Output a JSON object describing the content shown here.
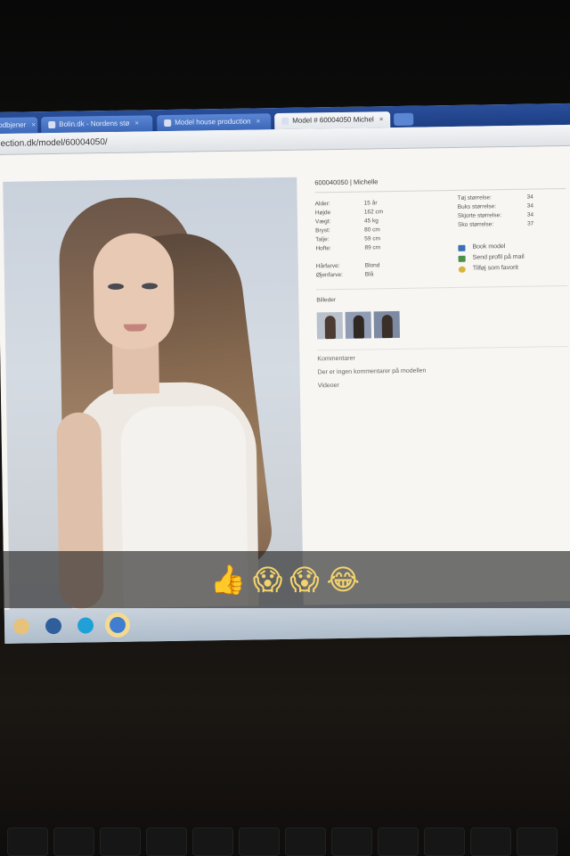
{
  "browser": {
    "tabs": [
      {
        "label": "odbjener"
      },
      {
        "label": "Bolin.dk - Nordens stø"
      },
      {
        "label": "Model house production"
      },
      {
        "label": "Model # 60004050 Michel"
      }
    ],
    "close_glyph": "×",
    "url": "ection.dk/model/60004050/"
  },
  "profile": {
    "header": "600040050 | Michelle",
    "stats": [
      {
        "label": "Alder:",
        "value": "15 år"
      },
      {
        "label": "Højde",
        "value": "162 cm"
      },
      {
        "label": "Vægt:",
        "value": "45 kg"
      },
      {
        "label": "Bryst:",
        "value": "80 cm"
      },
      {
        "label": "Talje:",
        "value": "59 cm"
      },
      {
        "label": "Hofte:",
        "value": "89 cm"
      }
    ],
    "features": [
      {
        "label": "Hårfarve:",
        "value": "Blond"
      },
      {
        "label": "Øjenfarve:",
        "value": "Blå"
      }
    ],
    "sizes": [
      {
        "label": "Tøj størrelse:",
        "value": "34"
      },
      {
        "label": "Buks størrelse:",
        "value": "34"
      },
      {
        "label": "Skjorte størrelse:",
        "value": "34"
      },
      {
        "label": "Sko størrelse:",
        "value": "37"
      }
    ],
    "actions": [
      {
        "label": "Book model",
        "icon": "calendar-icon",
        "color": "#3b6fb8"
      },
      {
        "label": "Send profil på mail",
        "icon": "mail-icon",
        "color": "#4b8f4b"
      },
      {
        "label": "Tilføj som favorit",
        "icon": "star-icon",
        "color": "#d7b43c"
      }
    ],
    "sections": {
      "images": "Billeder",
      "comments": "Kommentarer",
      "no_comments": "Der er ingen kommentarer på modellen",
      "videos": "Videoer"
    }
  },
  "caption": {
    "emojis": [
      "👍",
      "😱",
      "😱",
      "😂"
    ]
  },
  "colors": {
    "tab_bar": "#1d3e84",
    "page_bg": "#f7f6f3",
    "caption_bg": "#1e1e1e"
  }
}
